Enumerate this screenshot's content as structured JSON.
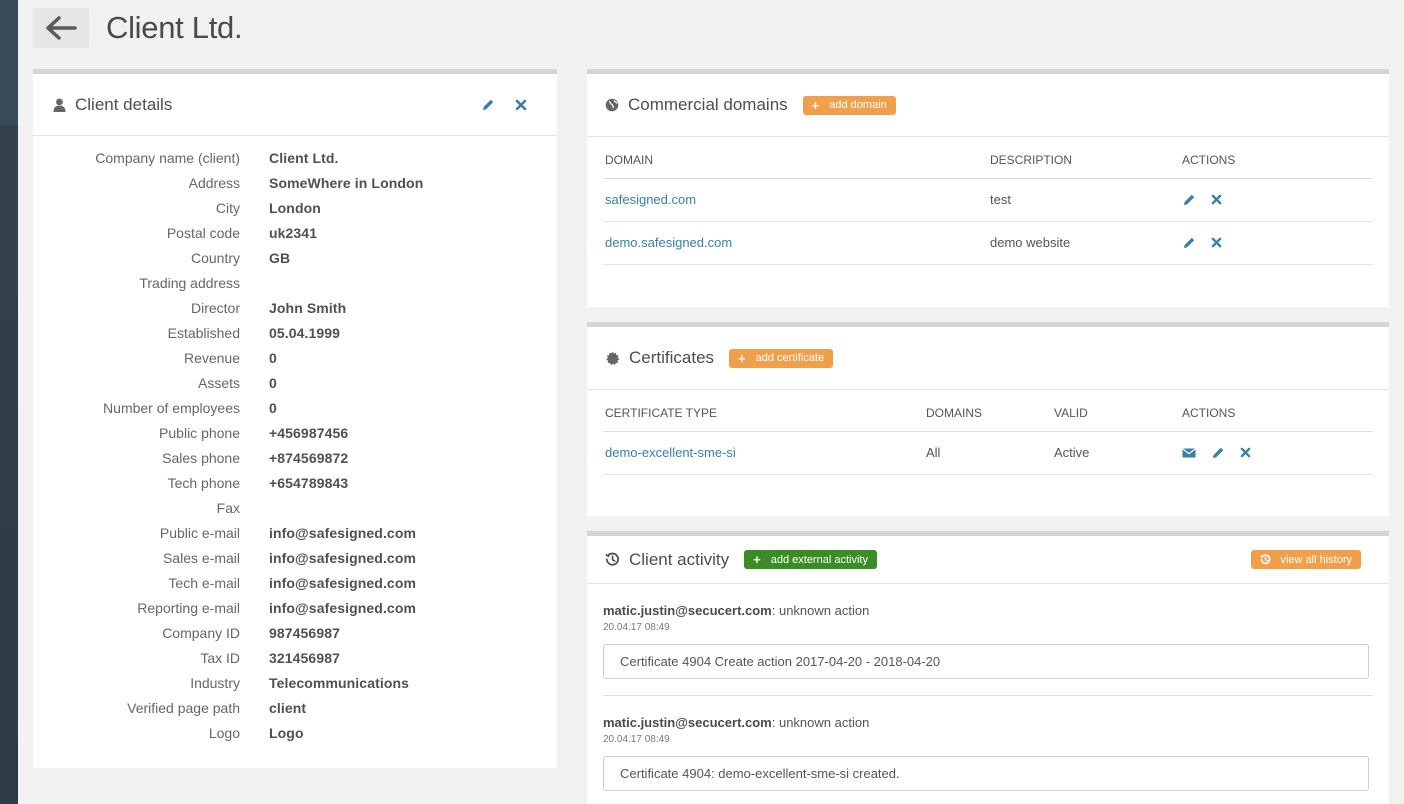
{
  "header": {
    "title": "Client Ltd."
  },
  "client_details": {
    "title": "Client details",
    "rows": [
      {
        "label": "Company name (client)",
        "value": "Client Ltd."
      },
      {
        "label": "Address",
        "value": "SomeWhere in London"
      },
      {
        "label": "City",
        "value": "London"
      },
      {
        "label": "Postal code",
        "value": "uk2341"
      },
      {
        "label": "Country",
        "value": "GB"
      },
      {
        "label": "Trading address",
        "value": ""
      },
      {
        "label": "Director",
        "value": "John Smith"
      },
      {
        "label": "Established",
        "value": "05.04.1999"
      },
      {
        "label": "Revenue",
        "value": "0"
      },
      {
        "label": "Assets",
        "value": "0"
      },
      {
        "label": "Number of employees",
        "value": "0"
      },
      {
        "label": "Public phone",
        "value": "+456987456"
      },
      {
        "label": "Sales phone",
        "value": "+874569872"
      },
      {
        "label": "Tech phone",
        "value": "+654789843"
      },
      {
        "label": "Fax",
        "value": ""
      },
      {
        "label": "Public e-mail",
        "value": "info@safesigned.com"
      },
      {
        "label": "Sales e-mail",
        "value": "info@safesigned.com"
      },
      {
        "label": "Tech e-mail",
        "value": "info@safesigned.com"
      },
      {
        "label": "Reporting e-mail",
        "value": "info@safesigned.com"
      },
      {
        "label": "Company ID",
        "value": "987456987"
      },
      {
        "label": "Tax ID",
        "value": "321456987"
      },
      {
        "label": "Industry",
        "value": "Telecommunications"
      },
      {
        "label": "Verified page path",
        "value": "client"
      },
      {
        "label": "Logo",
        "value": "Logo"
      }
    ]
  },
  "domains": {
    "title": "Commercial domains",
    "add_label": "add domain",
    "columns": [
      "DOMAIN",
      "DESCRIPTION",
      "ACTIONS"
    ],
    "rows": [
      {
        "domain": "safesigned.com",
        "description": "test"
      },
      {
        "domain": "demo.safesigned.com",
        "description": "demo website"
      }
    ]
  },
  "certificates": {
    "title": "Certificates",
    "add_label": "add certificate",
    "columns": [
      "CERTIFICATE TYPE",
      "DOMAINS",
      "VALID",
      "ACTIONS"
    ],
    "rows": [
      {
        "type": "demo-excellent-sme-si",
        "domains": "All",
        "valid": "Active"
      }
    ]
  },
  "activity": {
    "title": "Client activity",
    "add_label": "add external activity",
    "history_label": "view all history",
    "items": [
      {
        "user": "matic.justin@secucert.com",
        "action": ": unknown action",
        "time": "20.04.17 08:49",
        "text": "Certificate 4904 Create action 2017-04-20 - 2018-04-20"
      },
      {
        "user": "matic.justin@secucert.com",
        "action": ": unknown action",
        "time": "20.04.17 08:49",
        "text": "Certificate 4904: demo-excellent-sme-si created."
      }
    ]
  },
  "colors": {
    "accent_orange": "#f0a04b",
    "accent_green": "#3a8c25",
    "link": "#3a7fa8",
    "icon": "#3a7fa8"
  },
  "icons": [
    "back-arrow-icon",
    "user-icon",
    "edit-icon",
    "close-icon",
    "globe-icon",
    "certificate-icon",
    "history-icon",
    "mail-icon",
    "plus-icon"
  ]
}
